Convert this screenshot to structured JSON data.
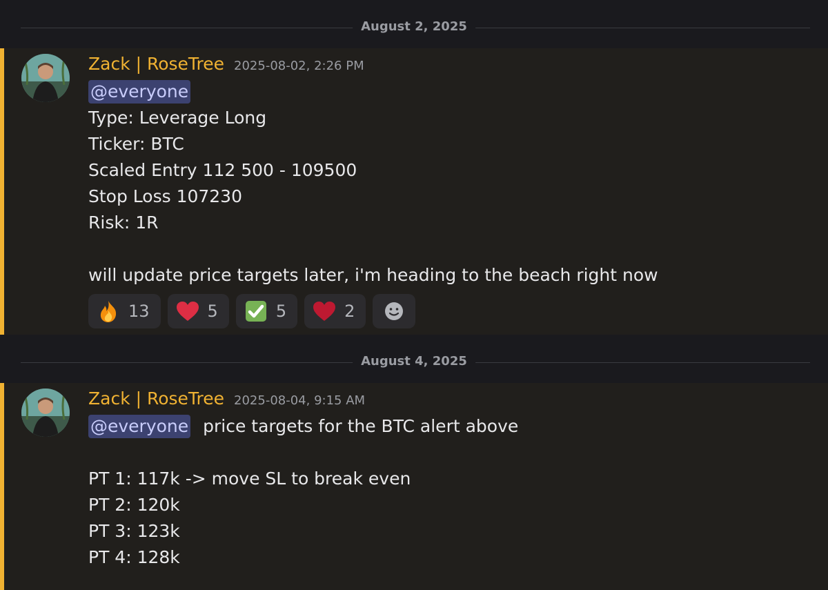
{
  "dividers": [
    {
      "label": "August 2, 2025"
    },
    {
      "label": "August 4, 2025"
    }
  ],
  "messages": [
    {
      "username": "Zack | RoseTree",
      "timestamp": "2025-08-02, 2:26 PM",
      "mention": "@everyone",
      "lines": [
        "Type: Leverage Long",
        "Ticker: BTC",
        "Scaled Entry 112 500 - 109500",
        "Stop Loss 107230",
        "Risk: 1R",
        "",
        "will update price targets later, i'm heading to the beach right now"
      ],
      "reactions": [
        {
          "emoji": "fire-emoji",
          "count": "13"
        },
        {
          "emoji": "red-heart-emoji",
          "count": "5"
        },
        {
          "emoji": "check-mark-emoji",
          "count": "5"
        },
        {
          "emoji": "heart-emoji",
          "count": "2"
        }
      ],
      "add_reaction_icon": "smiley-add-reaction-icon"
    },
    {
      "username": "Zack | RoseTree",
      "timestamp": "2025-08-04, 9:15 AM",
      "mention": "@everyone",
      "mention_suffix": "price targets for the BTC alert above",
      "lines": [
        "",
        "PT 1: 117k -> move SL to break even",
        "PT 2: 120k",
        "PT 3: 123k",
        "PT 4: 128k"
      ]
    }
  ],
  "colors": {
    "accent_username": "#f0b232",
    "mention_bg": "#3c4270",
    "mention_text": "#c9cdfb",
    "background": "#1a1a1e",
    "message_highlight": "#211f1c"
  }
}
